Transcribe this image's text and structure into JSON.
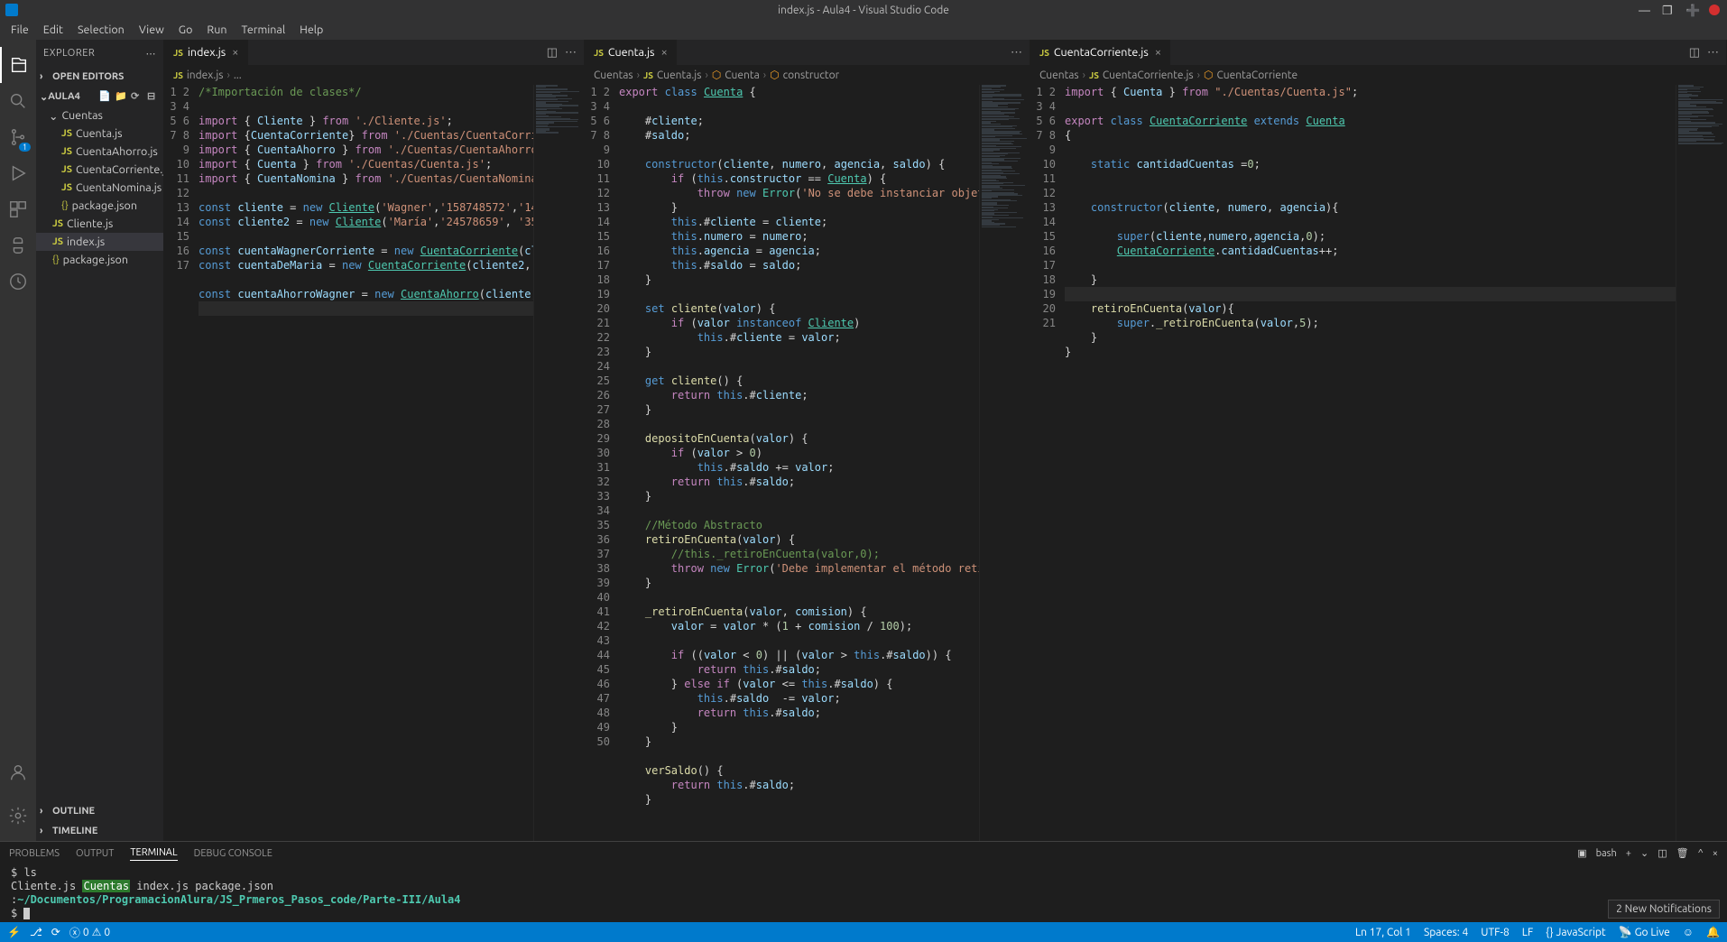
{
  "window": {
    "title": "index.js - Aula4 - Visual Studio Code"
  },
  "menu": [
    "File",
    "Edit",
    "Selection",
    "View",
    "Go",
    "Run",
    "Terminal",
    "Help"
  ],
  "sidebar": {
    "title": "EXPLORER",
    "openEditors": "OPEN EDITORS",
    "folder": "AULA4",
    "tree": {
      "folder1": "Cuentas",
      "files1": [
        "Cuenta.js",
        "CuentaAhorro.js",
        "CuentaCorriente.js",
        "CuentaNomina.js",
        "package.json"
      ],
      "files0": [
        "Cliente.js",
        "index.js",
        "package.json"
      ]
    },
    "outline": "OUTLINE",
    "timeline": "TIMELINE"
  },
  "tabs": {
    "t1": "index.js",
    "t2": "Cuenta.js",
    "t3": "CuentaCorriente.js"
  },
  "breadcrumbs": {
    "b1": [
      "index.js",
      "..."
    ],
    "b2": [
      "Cuentas",
      "Cuenta.js",
      "Cuenta",
      "constructor"
    ],
    "b3": [
      "Cuentas",
      "CuentaCorriente.js",
      "CuentaCorriente"
    ]
  },
  "panel": {
    "tabs": [
      "PROBLEMS",
      "OUTPUT",
      "TERMINAL",
      "DEBUG CONSOLE"
    ],
    "shell": "bash",
    "lines": {
      "l1": "$ ls",
      "l2a": "Cliente.js  ",
      "l2b": "Cuentas",
      "l2c": "   index.js  package.json",
      "l3a": ":",
      "l3b": "~/Documentos/ProgramacionAlura/JS_Prmeros_Pasos_code/Parte-III/Aula4",
      "l4": "$ "
    }
  },
  "status": {
    "branch": "⎇",
    "errors": "0",
    "warnings": "0",
    "ln": "Ln 17, Col 1",
    "spaces": "Spaces: 4",
    "enc": "UTF-8",
    "eol": "LF",
    "lang": "JavaScript",
    "golive": "Go Live",
    "notif": "2 New Notifications",
    "bell": "🔔"
  },
  "code1_lines": 17,
  "code2_lines": 50,
  "code3_lines": 21,
  "chart_data": null
}
